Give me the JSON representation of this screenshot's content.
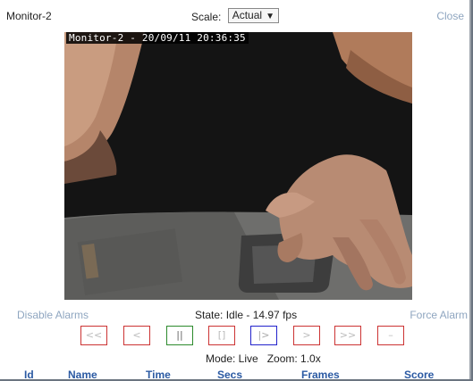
{
  "header": {
    "title": "Monitor-2",
    "scale_label": "Scale:",
    "scale_value": "Actual",
    "close_label": "Close"
  },
  "video": {
    "timestamp": "Monitor-2 - 20/09/11 20:36:35"
  },
  "alarms": {
    "disable_label": "Disable Alarms",
    "force_label": "Force Alarm"
  },
  "status": {
    "state_text": "State: Idle - 14.97 fps"
  },
  "controls": [
    {
      "name": "fast-rewind-button",
      "glyph": "<<"
    },
    {
      "name": "slow-rewind-button",
      "glyph": "<"
    },
    {
      "name": "pause-button",
      "glyph": "||"
    },
    {
      "name": "stop-button",
      "glyph": "[]"
    },
    {
      "name": "play-button",
      "glyph": "|>"
    },
    {
      "name": "slow-forward-button",
      "glyph": ">"
    },
    {
      "name": "fast-forward-button",
      "glyph": ">>"
    },
    {
      "name": "zoom-out-button",
      "glyph": "–"
    }
  ],
  "mode": {
    "text": "Mode: Live   Zoom: 1.0x"
  },
  "events_table": {
    "columns": [
      "Id",
      "Name",
      "Time",
      "Secs",
      "Frames",
      "Score"
    ]
  },
  "colors": {
    "link": "#8fa6c0",
    "heading": "#2b5aa3",
    "button_border": "#cc3333",
    "pause_border": "#2c8a2c",
    "play_border": "#2222cc"
  }
}
